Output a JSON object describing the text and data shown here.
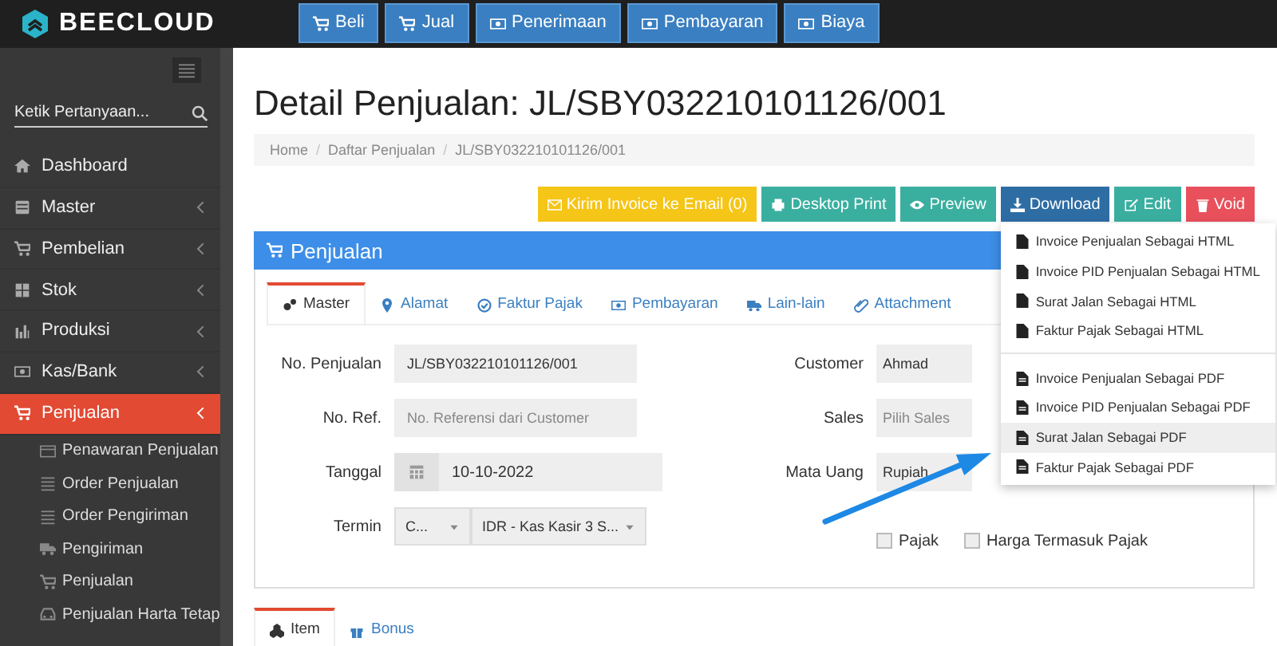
{
  "logo": {
    "text": "BEECLOUD"
  },
  "top_buttons": [
    {
      "label": "Beli"
    },
    {
      "label": "Jual"
    },
    {
      "label": "Penerimaan"
    },
    {
      "label": "Pembayaran"
    },
    {
      "label": "Biaya"
    }
  ],
  "sidebar": {
    "search": {
      "placeholder": "Ketik Pertanyaan..."
    },
    "items": [
      {
        "label": "Dashboard",
        "expandable": false,
        "selected": false
      },
      {
        "label": "Master",
        "expandable": true,
        "selected": false
      },
      {
        "label": "Pembelian",
        "expandable": true,
        "selected": false
      },
      {
        "label": "Stok",
        "expandable": true,
        "selected": false
      },
      {
        "label": "Produksi",
        "expandable": true,
        "selected": false
      },
      {
        "label": "Kas/Bank",
        "expandable": true,
        "selected": false
      },
      {
        "label": "Penjualan",
        "expandable": true,
        "selected": true,
        "children": [
          {
            "label": "Penawaran Penjualan"
          },
          {
            "label": "Order Penjualan"
          },
          {
            "label": "Order Pengiriman"
          },
          {
            "label": "Pengiriman"
          },
          {
            "label": "Penjualan"
          },
          {
            "label": "Penjualan Harta Tetap"
          }
        ]
      }
    ]
  },
  "page_title": "Detail Penjualan: JL/SBY032210101126/001",
  "breadcrumb": [
    {
      "kind": "link",
      "label": "Home"
    },
    {
      "kind": "separator",
      "label": "/"
    },
    {
      "kind": "link",
      "label": "Daftar Penjualan"
    },
    {
      "kind": "separator",
      "label": "/"
    },
    {
      "kind": "current",
      "label": "JL/SBY032210101126/001"
    }
  ],
  "actions": [
    {
      "label": "Kirim Invoice ke Email (0)",
      "color": "#f5c518"
    },
    {
      "label": "Desktop Print",
      "color": "#3aafa0"
    },
    {
      "label": "Preview",
      "color": "#3aafa0"
    },
    {
      "label": "Download",
      "color": "#2e6da4"
    },
    {
      "label": "Edit",
      "color": "#3aafa0"
    },
    {
      "label": "Void",
      "color": "#e8505b"
    }
  ],
  "download_menu": [
    {
      "label": "Invoice Penjualan Sebagai HTML",
      "kind": "html",
      "selected": false
    },
    {
      "label": "Invoice PID Penjualan Sebagai HTML",
      "kind": "html",
      "selected": false
    },
    {
      "label": "Surat Jalan Sebagai HTML",
      "kind": "html",
      "selected": false
    },
    {
      "label": "Faktur Pajak Sebagai HTML",
      "kind": "html",
      "selected": false
    },
    {
      "label": "Invoice Penjualan Sebagai PDF",
      "kind": "pdf",
      "selected": false
    },
    {
      "label": "Invoice PID Penjualan Sebagai PDF",
      "kind": "pdf",
      "selected": false
    },
    {
      "label": "Surat Jalan Sebagai PDF",
      "kind": "pdf",
      "selected": true
    },
    {
      "label": "Faktur Pajak Sebagai PDF",
      "kind": "pdf",
      "selected": false
    }
  ],
  "panel": {
    "title": "Penjualan",
    "tabs": [
      {
        "label": "Master",
        "selected": true
      },
      {
        "label": "Alamat",
        "selected": false
      },
      {
        "label": "Faktur Pajak",
        "selected": false
      },
      {
        "label": "Pembayaran",
        "selected": false
      },
      {
        "label": "Lain-lain",
        "selected": false
      },
      {
        "label": "Attachment",
        "selected": false
      }
    ],
    "left_fields": [
      {
        "label": "No. Penjualan",
        "kind": "text",
        "value": "JL/SBY032210101126/001"
      },
      {
        "label": "No. Ref.",
        "kind": "text",
        "placeholder": "No. Referensi dari Customer"
      },
      {
        "label": "Tanggal",
        "kind": "date",
        "value": "10-10-2022"
      },
      {
        "label": "Termin",
        "kind": "selects",
        "values": [
          "C...",
          "IDR - Kas Kasir 3 S..."
        ]
      }
    ],
    "right_fields": [
      {
        "label": "Customer",
        "kind": "text",
        "value": "Ahmad"
      },
      {
        "label": "Sales",
        "kind": "text",
        "placeholder": "Pilih Sales"
      },
      {
        "label": "Mata Uang",
        "kind": "text",
        "value": "Rupiah"
      }
    ],
    "checkboxes": [
      {
        "label": "Pajak",
        "checked": false
      },
      {
        "label": "Harga Termasuk Pajak",
        "checked": false
      }
    ]
  },
  "lower_tabs": [
    {
      "label": "Item",
      "selected": true
    },
    {
      "label": "Bonus",
      "selected": false
    }
  ]
}
